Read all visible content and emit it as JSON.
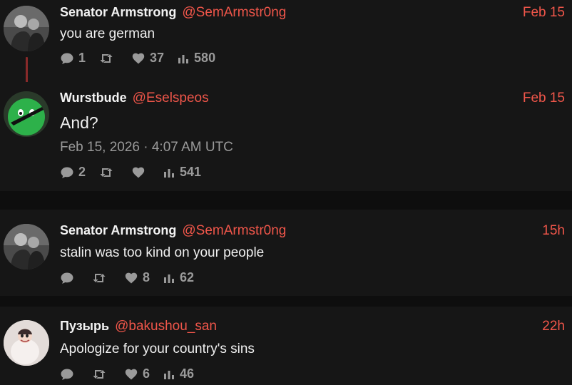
{
  "posts": [
    {
      "name": "Senator Armstrong",
      "handle": "@SemArmstr0ng",
      "date": "Feb 15",
      "text": "you are german",
      "replies": "1",
      "reposts": "",
      "likes": "37",
      "views": "580"
    },
    {
      "name": "Wurstbude",
      "handle": "@Eselspeos",
      "date": "Feb 15",
      "text": "And?",
      "timestamp": "Feb 15, 2026 · 4:07 AM UTC",
      "replies": "2",
      "reposts": "",
      "likes": "",
      "views": "541"
    },
    {
      "name": "Senator Armstrong",
      "handle": "@SemArmstr0ng",
      "date": "15h",
      "text": "stalin was too kind on your people",
      "replies": "",
      "reposts": "",
      "likes": "8",
      "views": "62"
    },
    {
      "name": "Пузырь",
      "handle": "@bakushou_san",
      "date": "22h",
      "text": "Apologize for your country's sins",
      "replies": "",
      "reposts": "",
      "likes": "6",
      "views": "46"
    }
  ],
  "colors": {
    "background": "#161616",
    "separator": "#0e0e0e",
    "accent": "#f0564a",
    "muted": "#9a9a9a",
    "thread_line": "#8a2a2a"
  },
  "icons": [
    "reply-icon",
    "repost-icon",
    "like-icon",
    "views-icon"
  ]
}
